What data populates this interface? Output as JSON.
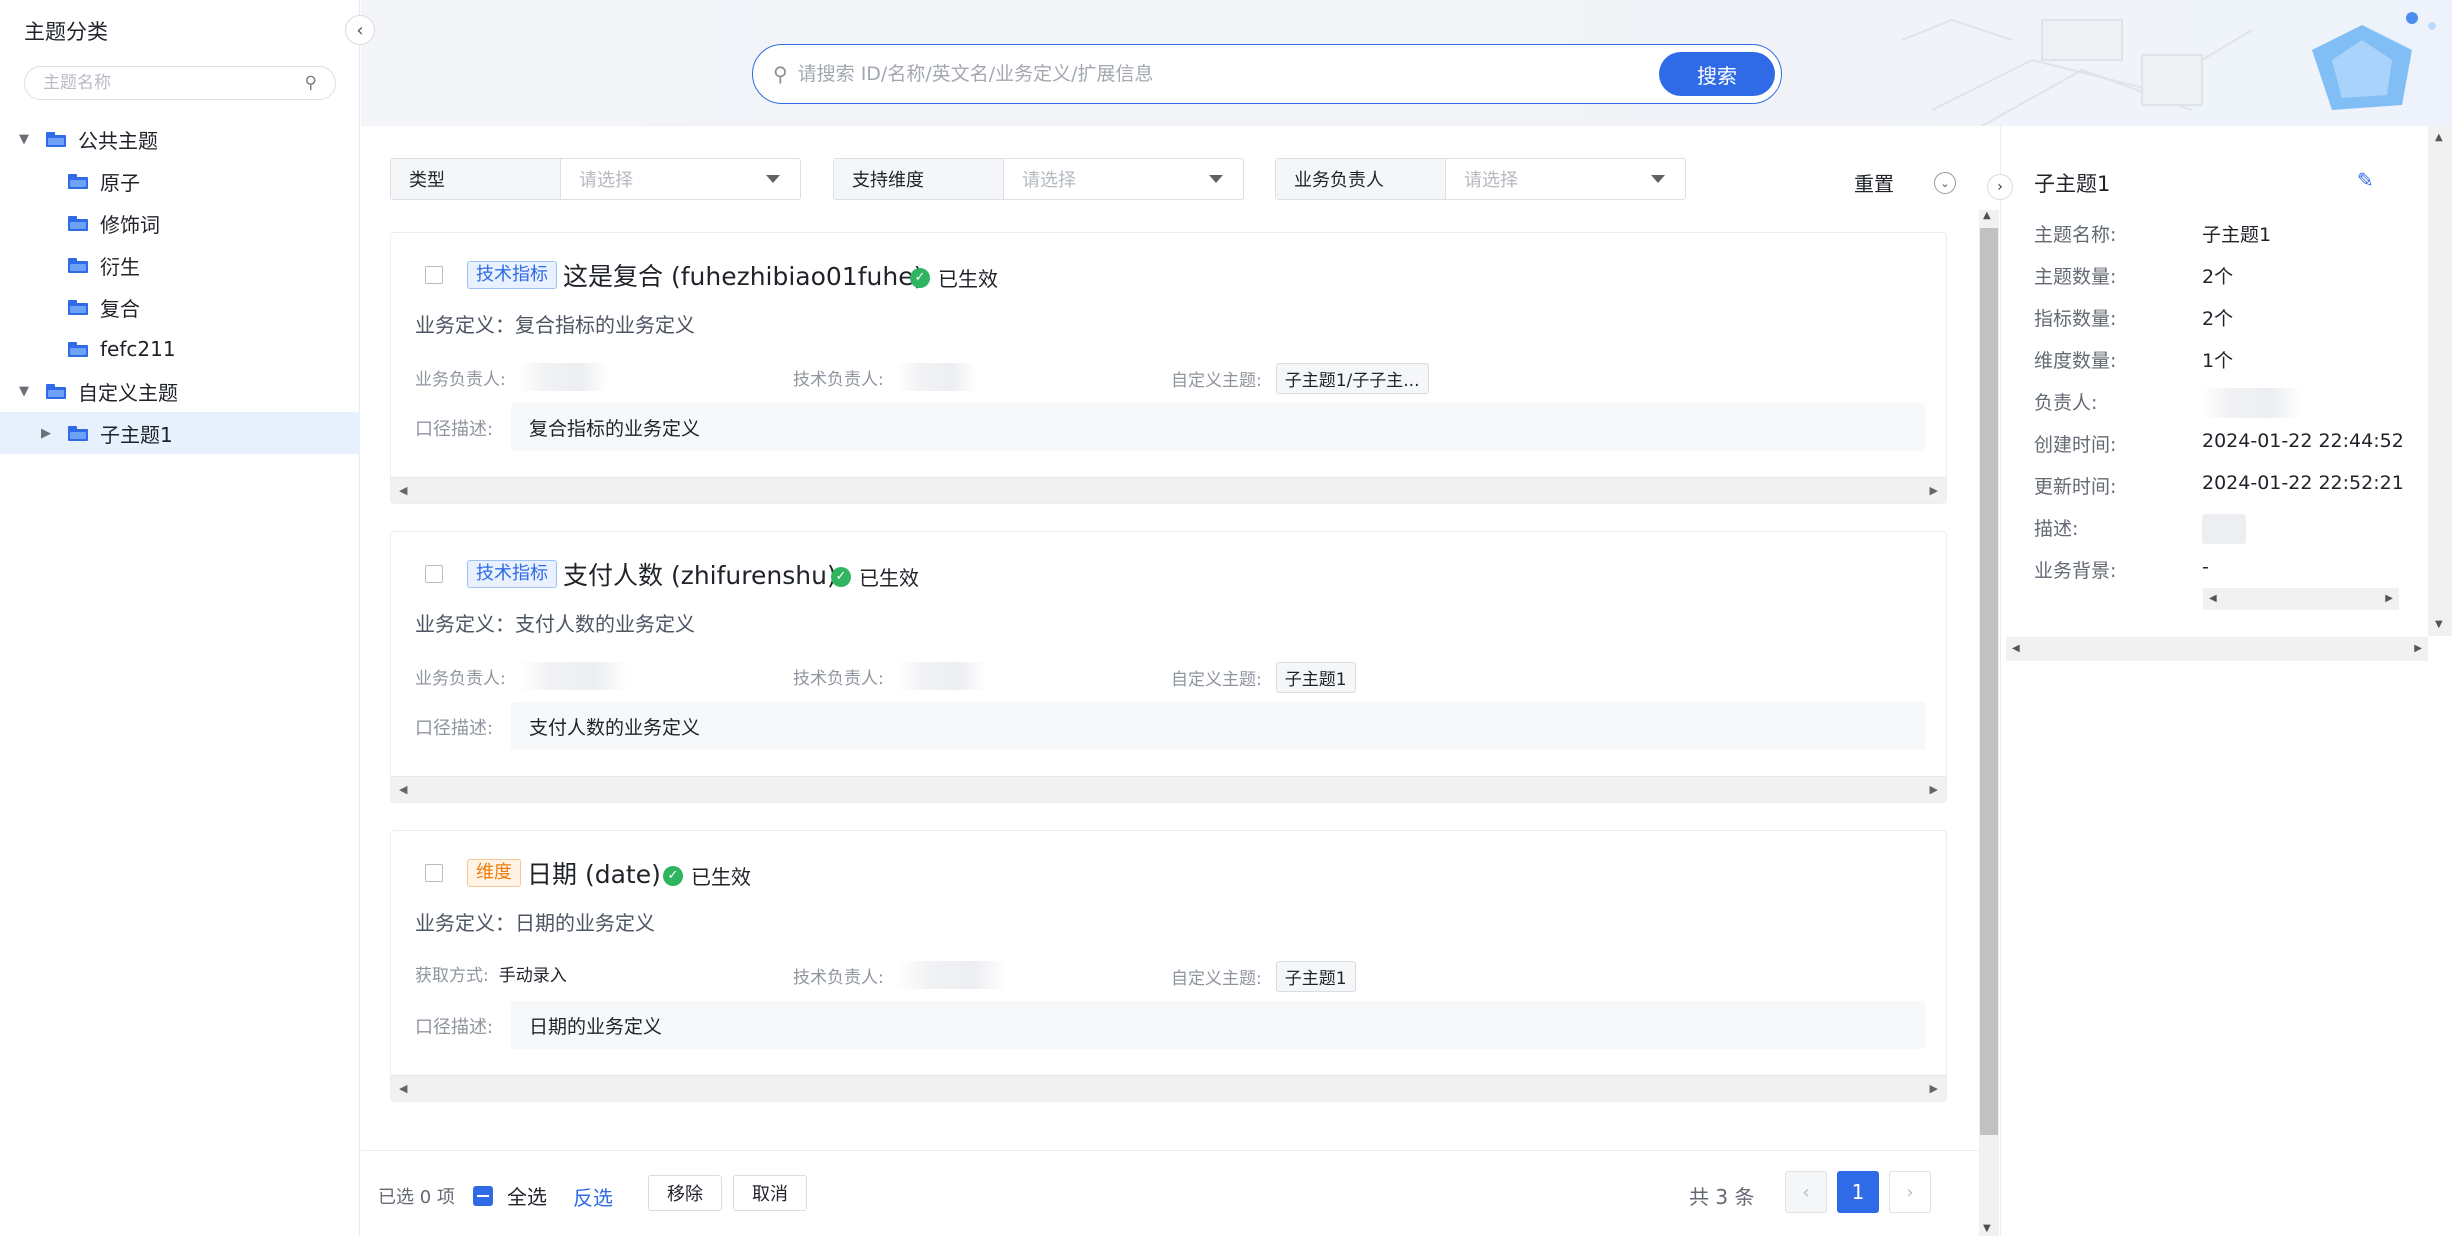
{
  "sidebar": {
    "title": "主题分类",
    "search_placeholder": "主题名称",
    "tree": [
      {
        "label": "公共主题",
        "level": 0,
        "expanded": true
      },
      {
        "label": "原子",
        "level": 1
      },
      {
        "label": "修饰词",
        "level": 1
      },
      {
        "label": "衍生",
        "level": 1
      },
      {
        "label": "复合",
        "level": 1
      },
      {
        "label": "fefc211",
        "level": 1
      },
      {
        "label": "自定义主题",
        "level": 0,
        "expanded": true
      },
      {
        "label": "子主题1",
        "level": 1,
        "selected": true,
        "expandable": true
      }
    ]
  },
  "search": {
    "placeholder": "请搜索 ID/名称/英文名/业务定义/扩展信息",
    "button": "搜索"
  },
  "filters": [
    {
      "label": "类型",
      "placeholder": "请选择"
    },
    {
      "label": "支持维度",
      "placeholder": "请选择"
    },
    {
      "label": "业务负责人",
      "placeholder": "请选择"
    }
  ],
  "reset_label": "重置",
  "cards": [
    {
      "tag": "技术指标",
      "title": "这是复合 (fuhezhibiao01fuhe)",
      "status": "已生效",
      "biz_def": "业务定义：复合指标的业务定义",
      "meta1_label": "业务负责人:",
      "meta1_value": "",
      "meta2_label": "技术负责人:",
      "meta3_label": "自定义主题:",
      "meta3_value": "子主题1/子子主...",
      "desc_label": "口径描述:",
      "desc": "复合指标的业务定义"
    },
    {
      "tag": "技术指标",
      "title": "支付人数 (zhifurenshu)",
      "status": "已生效",
      "biz_def": "业务定义：支付人数的业务定义",
      "meta1_label": "业务负责人:",
      "meta1_value": "",
      "meta2_label": "技术负责人:",
      "meta3_label": "自定义主题:",
      "meta3_value": "子主题1",
      "desc_label": "口径描述:",
      "desc": "支付人数的业务定义"
    },
    {
      "tag": "维度",
      "title": "日期 (date)",
      "status": "已生效",
      "biz_def": "业务定义：日期的业务定义",
      "meta1_label": "获取方式:",
      "meta1_value": "手动录入",
      "meta2_label": "技术负责人:",
      "meta3_label": "自定义主题:",
      "meta3_value": "子主题1",
      "desc_label": "口径描述:",
      "desc": "日期的业务定义"
    }
  ],
  "footer": {
    "selected": "已选 0 项",
    "select_all": "全选",
    "invert": "反选",
    "remove": "移除",
    "cancel": "取消",
    "total": "共 3 条",
    "page": "1"
  },
  "detail": {
    "title": "子主题1",
    "rows": [
      {
        "k": "主题名称:",
        "v": "子主题1"
      },
      {
        "k": "主题数量:",
        "v": "2个"
      },
      {
        "k": "指标数量:",
        "v": "2个"
      },
      {
        "k": "维度数量:",
        "v": "1个"
      },
      {
        "k": "负责人:",
        "v": ""
      },
      {
        "k": "创建时间:",
        "v": "2024-01-22 22:44:52"
      },
      {
        "k": "更新时间:",
        "v": "2024-01-22 22:52:21"
      },
      {
        "k": "描述:",
        "v": ""
      },
      {
        "k": "业务背景:",
        "v": "-"
      }
    ]
  },
  "colors": {
    "accent": "#2f6be6",
    "success": "#2fb560",
    "dimension_tag": "#f07c0b"
  }
}
